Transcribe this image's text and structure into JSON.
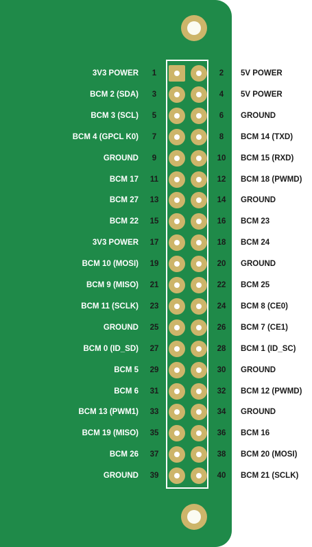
{
  "rows": [
    {
      "left_label": "3V3 POWER",
      "left_pin": "1",
      "right_pin": "2",
      "right_label": "5V POWER"
    },
    {
      "left_label": "BCM 2 (SDA)",
      "left_pin": "3",
      "right_pin": "4",
      "right_label": "5V POWER"
    },
    {
      "left_label": "BCM 3 (SCL)",
      "left_pin": "5",
      "right_pin": "6",
      "right_label": "GROUND"
    },
    {
      "left_label": "BCM 4 (GPCL K0)",
      "left_pin": "7",
      "right_pin": "8",
      "right_label": "BCM 14 (TXD)"
    },
    {
      "left_label": "GROUND",
      "left_pin": "9",
      "right_pin": "10",
      "right_label": "BCM 15 (RXD)"
    },
    {
      "left_label": "BCM 17",
      "left_pin": "11",
      "right_pin": "12",
      "right_label": "BCM 18 (PWMD)"
    },
    {
      "left_label": "BCM 27",
      "left_pin": "13",
      "right_pin": "14",
      "right_label": "GROUND"
    },
    {
      "left_label": "BCM 22",
      "left_pin": "15",
      "right_pin": "16",
      "right_label": "BCM 23"
    },
    {
      "left_label": "3V3 POWER",
      "left_pin": "17",
      "right_pin": "18",
      "right_label": "BCM 24"
    },
    {
      "left_label": "BCM 10 (MOSI)",
      "left_pin": "19",
      "right_pin": "20",
      "right_label": "GROUND"
    },
    {
      "left_label": "BCM 9 (MISO)",
      "left_pin": "21",
      "right_pin": "22",
      "right_label": "BCM 25"
    },
    {
      "left_label": "BCM 11 (SCLK)",
      "left_pin": "23",
      "right_pin": "24",
      "right_label": "BCM 8 (CE0)"
    },
    {
      "left_label": "GROUND",
      "left_pin": "25",
      "right_pin": "26",
      "right_label": "BCM 7 (CE1)"
    },
    {
      "left_label": "BCM 0 (ID_SD)",
      "left_pin": "27",
      "right_pin": "28",
      "right_label": "BCM 1 (ID_SC)"
    },
    {
      "left_label": "BCM 5",
      "left_pin": "29",
      "right_pin": "30",
      "right_label": "GROUND"
    },
    {
      "left_label": "BCM 6",
      "left_pin": "31",
      "right_pin": "32",
      "right_label": "BCM 12 (PWMD)"
    },
    {
      "left_label": "BCM 13 (PWM1)",
      "left_pin": "33",
      "right_pin": "34",
      "right_label": "GROUND"
    },
    {
      "left_label": "BCM 19 (MISO)",
      "left_pin": "35",
      "right_pin": "36",
      "right_label": "BCM 16"
    },
    {
      "left_label": "BCM 26",
      "left_pin": "37",
      "right_pin": "38",
      "right_label": "BCM 20 (MOSI)"
    },
    {
      "left_label": "GROUND",
      "left_pin": "39",
      "right_pin": "40",
      "right_label": "BCM 21 (SCLK)"
    }
  ],
  "colors": {
    "board": "#1f8a49",
    "pad": "#cdb56a",
    "left_text": "#ffffff",
    "right_text": "#1a1a1a"
  }
}
